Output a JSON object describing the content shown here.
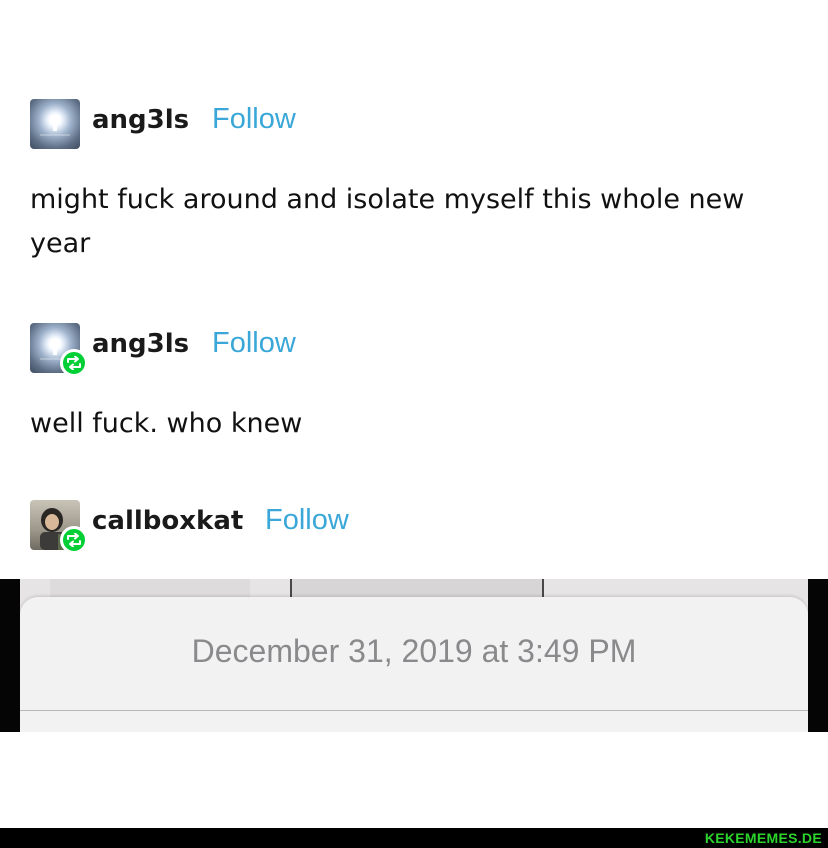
{
  "posts": [
    {
      "username": "ang3ls",
      "follow_label": "Follow",
      "text": "might fuck around and isolate myself this whole new year",
      "avatar_icon": "glowing-figure-avatar",
      "reblog": false
    },
    {
      "username": "ang3ls",
      "follow_label": "Follow",
      "text": "well fuck. who knew",
      "avatar_icon": "glowing-figure-avatar",
      "reblog": true
    },
    {
      "username": "callboxkat",
      "follow_label": "Follow",
      "avatar_icon": "character-avatar",
      "reblog": true
    }
  ],
  "screenshot": {
    "date_text": "December 31, 2019 at 3:49 PM"
  },
  "watermark": "KEKEMEMES.DE",
  "colors": {
    "follow": "#3aa7d8",
    "reblog_badge": "#00cf35",
    "watermark": "#2bd42b"
  }
}
